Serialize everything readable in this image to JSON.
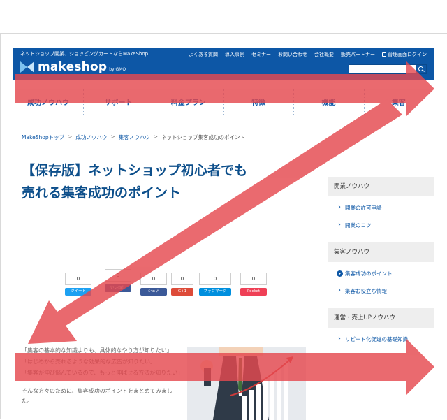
{
  "header": {
    "tagline": "ネットショップ開業、ショッピングカートならMakeShop",
    "logo_text": "makeshop",
    "logo_sub": "by GMO",
    "top_links": [
      "よくある質問",
      "導入事例",
      "セミナー",
      "お問い合わせ",
      "会社概要",
      "販売パートナー"
    ],
    "admin_login": "管理画面ログイン",
    "search_placeholder": ""
  },
  "nav": {
    "items": [
      "成功ノウハウ",
      "サポート",
      "料金プラン",
      "特徴",
      "機能",
      "集客"
    ]
  },
  "breadcrumb": {
    "items": [
      "MakeShopトップ",
      "成功ノウハウ",
      "集客ノウハウ"
    ],
    "current": "ネットショップ集客成功のポイント",
    "separator": ">"
  },
  "article": {
    "title_line1": "【保存版】ネットショップ初心者でも",
    "title_line2": "売れる集客成功のポイント",
    "share": [
      {
        "count": "0",
        "label": "ツイート",
        "color": "#1da1f2"
      },
      {
        "count": "0",
        "label": "いいね！",
        "color": "#3b5998"
      },
      {
        "count": "0",
        "label": "シェア",
        "color": "#3b5998"
      },
      {
        "count": "0",
        "label": "G+1",
        "color": "#dd4b39"
      },
      {
        "count": "0",
        "label": "ブックマーク",
        "color": "#008fde"
      },
      {
        "count": "0",
        "label": "Pocket",
        "color": "#ef4056"
      }
    ],
    "intro_lines": [
      "「集客の基本的な知識よりも、具体的なやり方が知りたい」",
      "「はじめから売れるような効果的な広告が知りたい」",
      "「集客が伸び悩んでいるので、もっと伸ばせる方法が知りたい」"
    ],
    "closing": "そんな方々のために、集客成功のポイントをまとめてみました。"
  },
  "sidebar": {
    "sections": [
      {
        "heading": "開業ノウハウ",
        "items": [
          "開業の許可申請",
          "開業のコツ"
        ]
      },
      {
        "heading": "集客ノウハウ",
        "items": [
          "集客成功のポイント",
          "集客お役立ち情報"
        ],
        "active": 0
      },
      {
        "heading": "運営・売上UPノウハウ",
        "items": [
          "リピート化促進の基礎知識"
        ]
      }
    ]
  },
  "colors": {
    "brand_blue": "#0d57a6",
    "title_blue": "#0d4f8b",
    "arrow_red": "#e5494f"
  }
}
